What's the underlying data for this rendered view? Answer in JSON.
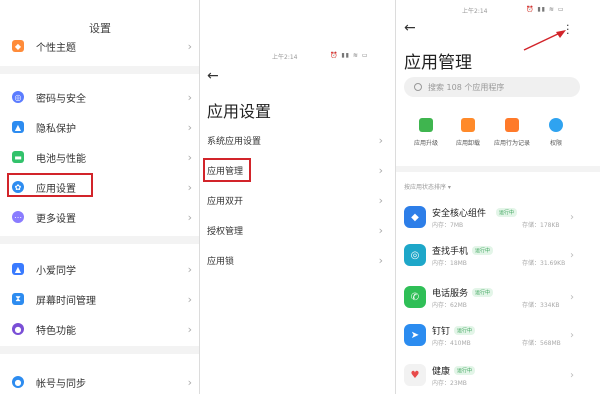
{
  "status": {
    "time_left": "上午2:14",
    "time_right": "上午2:14",
    "icons": "⏰ ▮▮ ≋ ▭"
  },
  "settings": {
    "title": "设置",
    "items": [
      {
        "label": "个性主题",
        "color": "#ff8c3a"
      },
      {
        "label": "密码与安全",
        "color": "#5b7cff"
      },
      {
        "label": "隐私保护",
        "color": "#2d8cf0"
      },
      {
        "label": "电池与性能",
        "color": "#32c26b"
      },
      {
        "label": "应用设置",
        "color": "#2d8cf0"
      },
      {
        "label": "更多设置",
        "color": "#8a7cff"
      },
      {
        "label": "小爱同学",
        "color": "#3a7bff"
      },
      {
        "label": "屏幕时间管理",
        "color": "#2d8cf0"
      },
      {
        "label": "特色功能",
        "color": "#7a4fd6"
      },
      {
        "label": "帐号与同步",
        "color": "#2d8cf0"
      }
    ]
  },
  "app_settings": {
    "title": "应用设置",
    "items": [
      {
        "label": "系统应用设置"
      },
      {
        "label": "应用管理"
      },
      {
        "label": "应用双开"
      },
      {
        "label": "授权管理"
      },
      {
        "label": "应用锁"
      }
    ]
  },
  "app_manage": {
    "title": "应用管理",
    "search_placeholder": "搜索 108 个应用程序",
    "tools": [
      {
        "label": "应用升级",
        "color": "#3fb54f"
      },
      {
        "label": "应用卸载",
        "color": "#ff8a2a"
      },
      {
        "label": "应用行为记录",
        "color": "#ff7a2a"
      },
      {
        "label": "权限",
        "color": "#2fa3f0"
      }
    ],
    "section": "按应用状态排序 ▾",
    "apps": [
      {
        "name": "安全核心组件",
        "badge": "运行中",
        "memory": "内存：7MB",
        "storage": "存储：178KB",
        "color": "#2d7ee8",
        "glyph": "◆"
      },
      {
        "name": "查找手机",
        "badge": "运行中",
        "memory": "内存：18MB",
        "storage": "存储：31.69KB",
        "color": "#1ea7c9",
        "glyph": "◎"
      },
      {
        "name": "电话服务",
        "badge": "运行中",
        "memory": "内存：62MB",
        "storage": "存储：334KB",
        "color": "#2fbf57",
        "glyph": "✆"
      },
      {
        "name": "钉钉",
        "badge": "运行中",
        "memory": "内存：410MB",
        "storage": "存储：568MB",
        "color": "#2b8cf0",
        "glyph": "➤"
      },
      {
        "name": "健康",
        "badge": "运行中",
        "memory": "内存：23MB",
        "storage": "",
        "color": "#f2f2f2",
        "glyph": "♥"
      }
    ]
  }
}
